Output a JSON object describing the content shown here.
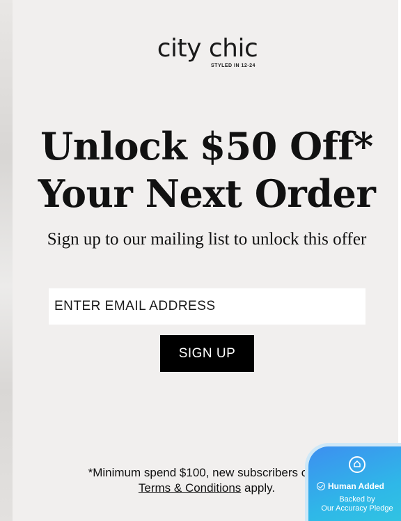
{
  "brand": {
    "name": "city chic",
    "tagline": "STYLED IN 12-24"
  },
  "headline": {
    "line1": "Unlock $50 Off*",
    "line2": "Your Next Order"
  },
  "subline": "Sign up to our mailing list to unlock this offer",
  "form": {
    "email_placeholder": "ENTER EMAIL ADDRESS",
    "email_value": "",
    "submit_label": "SIGN UP"
  },
  "footnote": {
    "text": "*Minimum spend $100, new subscribers only.",
    "terms_link": "Terms & Conditions",
    "suffix": " apply."
  },
  "badge": {
    "title": "Human Added",
    "line1": "Backed by",
    "line2": "Our Accuracy Pledge"
  },
  "colors": {
    "background": "#f1efee",
    "button": "#000000",
    "badge": "#2fb7e8"
  }
}
